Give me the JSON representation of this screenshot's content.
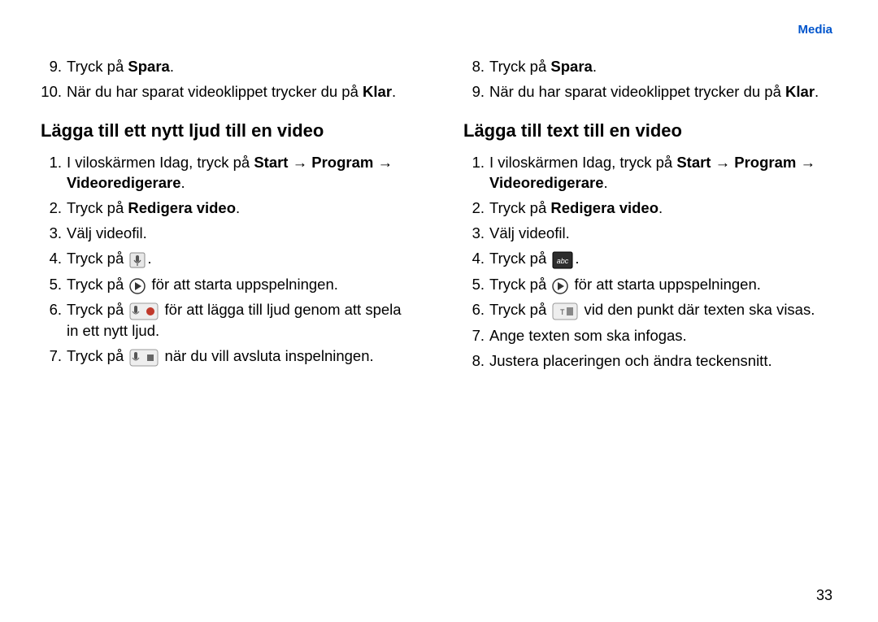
{
  "header": {
    "section_label": "Media"
  },
  "left": {
    "steps_a": [
      {
        "num": "9.",
        "parts": [
          "Tryck på ",
          {
            "b": "Spara"
          },
          "."
        ]
      },
      {
        "num": "10.",
        "parts": [
          "När du har sparat videoklippet trycker du på ",
          {
            "b": "Klar"
          },
          "."
        ]
      }
    ],
    "heading": "Lägga till ett nytt ljud till en video",
    "steps_b": [
      {
        "num": "1.",
        "parts": [
          "I viloskärmen Idag, tryck på ",
          {
            "b": "Start"
          },
          " → ",
          {
            "b": "Program"
          },
          " → ",
          {
            "b": "Videoredigerare"
          },
          "."
        ]
      },
      {
        "num": "2.",
        "parts": [
          "Tryck på ",
          {
            "b": "Redigera video"
          },
          "."
        ]
      },
      {
        "num": "3.",
        "parts": [
          "Välj videofil."
        ]
      },
      {
        "num": "4.",
        "parts": [
          "Tryck på ",
          {
            "icon": "mic-small"
          },
          "."
        ]
      },
      {
        "num": "5.",
        "parts": [
          "Tryck på ",
          {
            "icon": "play-circle"
          },
          " för att starta uppspelningen."
        ]
      },
      {
        "num": "6.",
        "parts": [
          "Tryck på ",
          {
            "icon": "mic-record"
          },
          " för att lägga till ljud genom att spela in ett nytt ljud."
        ]
      },
      {
        "num": "7.",
        "parts": [
          "Tryck på ",
          {
            "icon": "mic-stop"
          },
          " när du vill avsluta inspelningen."
        ]
      }
    ]
  },
  "right": {
    "steps_a": [
      {
        "num": "8.",
        "parts": [
          "Tryck på ",
          {
            "b": "Spara"
          },
          "."
        ]
      },
      {
        "num": "9.",
        "parts": [
          "När du har sparat videoklippet trycker du på ",
          {
            "b": "Klar"
          },
          "."
        ]
      }
    ],
    "heading": "Lägga till text till en video",
    "steps_b": [
      {
        "num": "1.",
        "parts": [
          "I viloskärmen Idag, tryck på ",
          {
            "b": "Start"
          },
          " → ",
          {
            "b": "Program"
          },
          " → ",
          {
            "b": "Videoredigerare"
          },
          "."
        ]
      },
      {
        "num": "2.",
        "parts": [
          "Tryck på ",
          {
            "b": "Redigera video"
          },
          "."
        ]
      },
      {
        "num": "3.",
        "parts": [
          "Välj videofil."
        ]
      },
      {
        "num": "4.",
        "parts": [
          "Tryck på ",
          {
            "icon": "text-abc"
          },
          "."
        ]
      },
      {
        "num": "5.",
        "parts": [
          "Tryck på ",
          {
            "icon": "play-circle"
          },
          " för att starta uppspelningen."
        ]
      },
      {
        "num": "6.",
        "parts": [
          "Tryck på ",
          {
            "icon": "text-marker"
          },
          " vid den punkt där texten ska visas."
        ]
      },
      {
        "num": "7.",
        "parts": [
          "Ange texten som ska infogas."
        ]
      },
      {
        "num": "8.",
        "parts": [
          "Justera placeringen och ändra teckensnitt."
        ]
      }
    ]
  },
  "page_number": "33",
  "icons": {
    "mic-small": "mic-small",
    "play-circle": "play-circle",
    "mic-record": "mic-record",
    "mic-stop": "mic-stop",
    "text-abc": "text-abc",
    "text-marker": "text-marker"
  }
}
